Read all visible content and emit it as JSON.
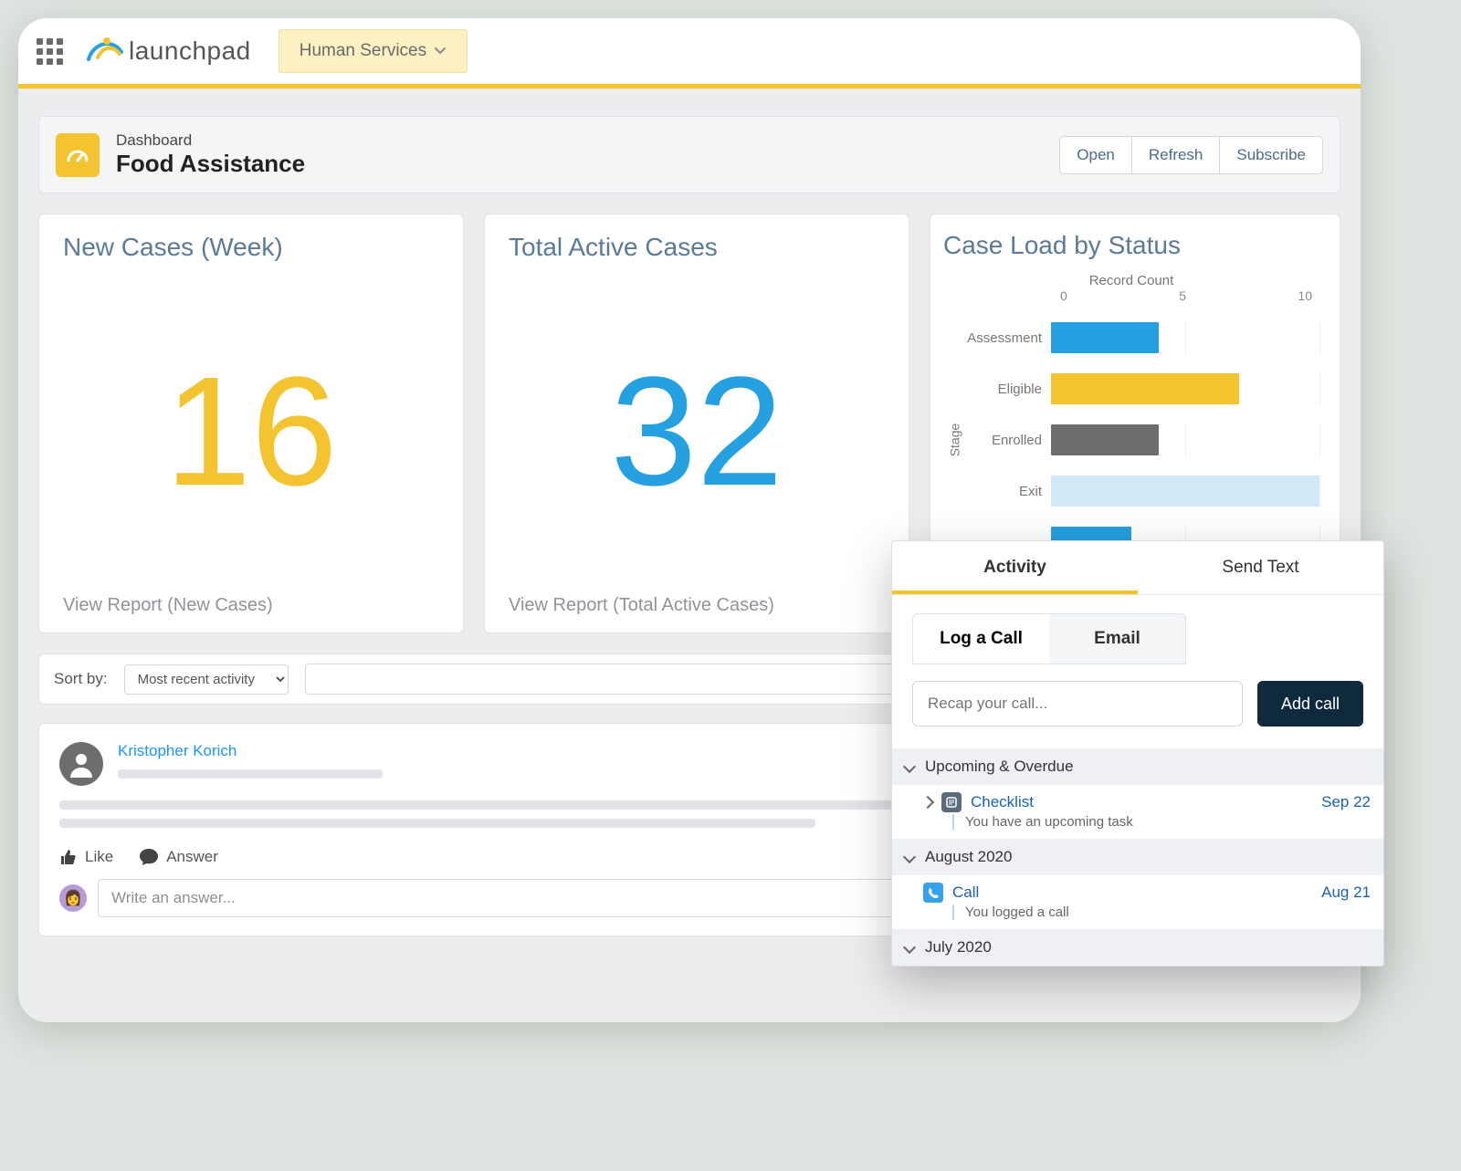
{
  "brand": {
    "name": "launchpad"
  },
  "context_switcher": {
    "label": "Human Services"
  },
  "page_header": {
    "eyebrow": "Dashboard",
    "title": "Food Assistance",
    "actions": {
      "open": "Open",
      "refresh": "Refresh",
      "subscribe": "Subscribe"
    }
  },
  "cards": {
    "new_cases": {
      "title": "New Cases (Week)",
      "value": "16",
      "footer": "View Report (New Cases)"
    },
    "total_active": {
      "title": "Total Active Cases",
      "value": "32",
      "footer": "View Report (Total Active Cases)"
    },
    "case_load": {
      "title": "Case Load by Status"
    }
  },
  "chart_data": {
    "type": "bar",
    "orientation": "horizontal",
    "title": "Case Load by Status",
    "xlabel": "Record Count",
    "ylabel": "Stage",
    "xlim": [
      0,
      10
    ],
    "ticks": [
      0,
      5,
      10
    ],
    "categories": [
      "Assessment",
      "Eligible",
      "Enrolled",
      "Exit",
      ""
    ],
    "values": [
      4,
      7,
      4,
      10,
      3
    ],
    "colors": [
      "#25a0e0",
      "#f4c430",
      "#6d6d6d",
      "#cfe9f7",
      "#25a0e0"
    ]
  },
  "controls": {
    "sort_label": "Sort by:",
    "sort_value": "Most recent activity"
  },
  "feed": {
    "user_name": "Kristopher Korich",
    "like_label": "Like",
    "answer_label": "Answer",
    "answer_placeholder": "Write an answer..."
  },
  "activity_panel": {
    "tabs": {
      "activity": "Activity",
      "send_text": "Send Text"
    },
    "subtabs": {
      "log_call": "Log a Call",
      "email": "Email"
    },
    "recap_placeholder": "Recap your call...",
    "add_call": "Add call",
    "sections": {
      "upcoming": {
        "title": "Upcoming & Overdue",
        "item_title": "Checklist",
        "item_date": "Sep 22",
        "item_sub": "You have an upcoming task"
      },
      "august": {
        "title": "August 2020",
        "item_title": "Call",
        "item_date": "Aug 21",
        "item_sub": "You logged a call"
      },
      "july": {
        "title": "July 2020"
      }
    }
  }
}
